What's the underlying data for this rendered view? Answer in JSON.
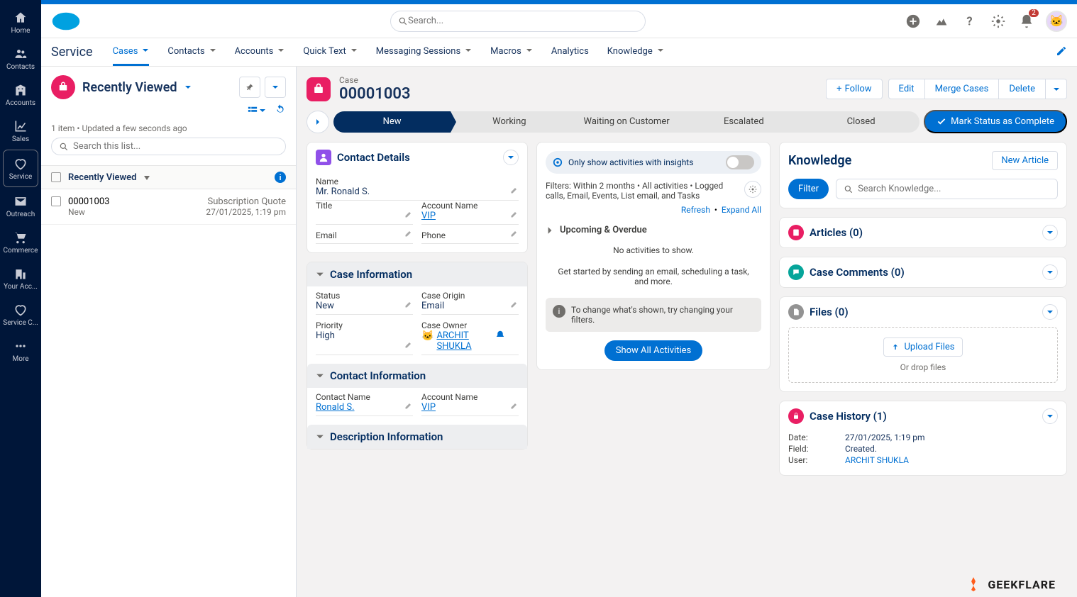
{
  "vnav": [
    "Home",
    "Contacts",
    "Accounts",
    "Sales",
    "Service",
    "Outreach",
    "Commerce",
    "Your Acc...",
    "Service C...",
    "More"
  ],
  "search_placeholder": "Search...",
  "notif_count": "2",
  "app_title": "Service",
  "nav_tabs": [
    "Cases",
    "Contacts",
    "Accounts",
    "Quick Text",
    "Messaging Sessions",
    "Macros",
    "Analytics",
    "Knowledge"
  ],
  "list": {
    "title": "Recently Viewed",
    "meta": "1 item • Updated a few seconds ago",
    "search_ph": "Search this list...",
    "col_header": "Recently Viewed",
    "row": {
      "num": "00001003",
      "status": "New",
      "subj": "Subscription Quote",
      "dt": "27/01/2025, 1:19 pm"
    }
  },
  "case": {
    "label": "Case",
    "number": "00001003",
    "actions": {
      "follow": "Follow",
      "edit": "Edit",
      "merge": "Merge Cases",
      "delete": "Delete"
    },
    "path": [
      "New",
      "Working",
      "Waiting on Customer",
      "Escalated",
      "Closed"
    ],
    "complete": "Mark Status as Complete"
  },
  "contact": {
    "title": "Contact Details",
    "name_lbl": "Name",
    "name": "Mr. Ronald S.",
    "title_lbl": "Title",
    "acct_lbl": "Account Name",
    "acct": "VIP",
    "email_lbl": "Email",
    "phone_lbl": "Phone"
  },
  "caseinfo": {
    "title": "Case Information",
    "status_lbl": "Status",
    "status": "New",
    "origin_lbl": "Case Origin",
    "origin": "Email",
    "priority_lbl": "Priority",
    "priority": "High",
    "owner_lbl": "Case Owner",
    "owner": "ARCHIT SHUKLA"
  },
  "contactinfo": {
    "title": "Contact Information",
    "cname_lbl": "Contact Name",
    "cname": "Ronald S.",
    "acct_lbl": "Account Name",
    "acct": "VIP"
  },
  "descinfo": {
    "title": "Description Information"
  },
  "activities": {
    "insights": "Only show activities with insights",
    "filters": "Filters: Within 2 months • All activities • Logged calls, Email, Events, List email, and Tasks",
    "refresh": "Refresh",
    "expand": "Expand All",
    "upcoming": "Upcoming & Overdue",
    "empty1": "No activities to show.",
    "empty2": "Get started by sending an email, scheduling a task, and more.",
    "tip": "To change what's shown, try changing your filters.",
    "show_all": "Show All Activities"
  },
  "knowledge": {
    "title": "Knowledge",
    "new": "New Article",
    "filter": "Filter",
    "search_ph": "Search Knowledge..."
  },
  "articles": "Articles (0)",
  "comments": "Case Comments (0)",
  "files": {
    "title": "Files (0)",
    "upload": "Upload Files",
    "drop": "Or drop files"
  },
  "history": {
    "title": "Case History (1)",
    "date_k": "Date:",
    "date_v": "27/01/2025, 1:19 pm",
    "field_k": "Field:",
    "field_v": "Created.",
    "user_k": "User:",
    "user_v": "ARCHIT SHUKLA"
  },
  "brand": "GEEKFLARE"
}
